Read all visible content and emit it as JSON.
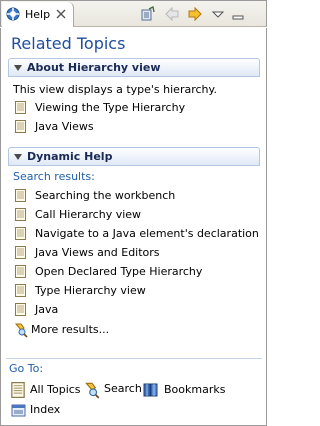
{
  "view": {
    "tab_label": "Help"
  },
  "page": {
    "title": "Related Topics"
  },
  "about_section": {
    "title": "About Hierarchy view",
    "description": "This view displays a type's hierarchy.",
    "links": [
      "Viewing the Type Hierarchy",
      "Java Views"
    ]
  },
  "dynamic_section": {
    "title": "Dynamic Help",
    "search_label": "Search results:",
    "links": [
      "Searching the workbench",
      "Call Hierarchy view",
      "Navigate to a Java element's declaration",
      "Java Views and Editors",
      "Open Declared Type Hierarchy",
      "Type Hierarchy view",
      "Java"
    ],
    "more_results": "More results..."
  },
  "goto": {
    "label": "Go To:",
    "all_topics": "All Topics",
    "search": "Search",
    "bookmarks": "Bookmarks",
    "index": "Index"
  },
  "icons": {
    "tab": "help-icon",
    "close": "close-icon",
    "toolbar": [
      "show-in-contents-icon",
      "back-icon",
      "forward-icon",
      "view-menu-icon",
      "minimize-icon"
    ],
    "topic": "document-icon",
    "more": "search-icon",
    "all_topics": "document-icon",
    "search": "search-icon",
    "bookmarks": "bookmarks-icon",
    "index": "index-icon"
  },
  "colors": {
    "title": "#1f4e9c",
    "section_bg": "#dfe8f6",
    "link_blue": "#1f5fa8"
  }
}
